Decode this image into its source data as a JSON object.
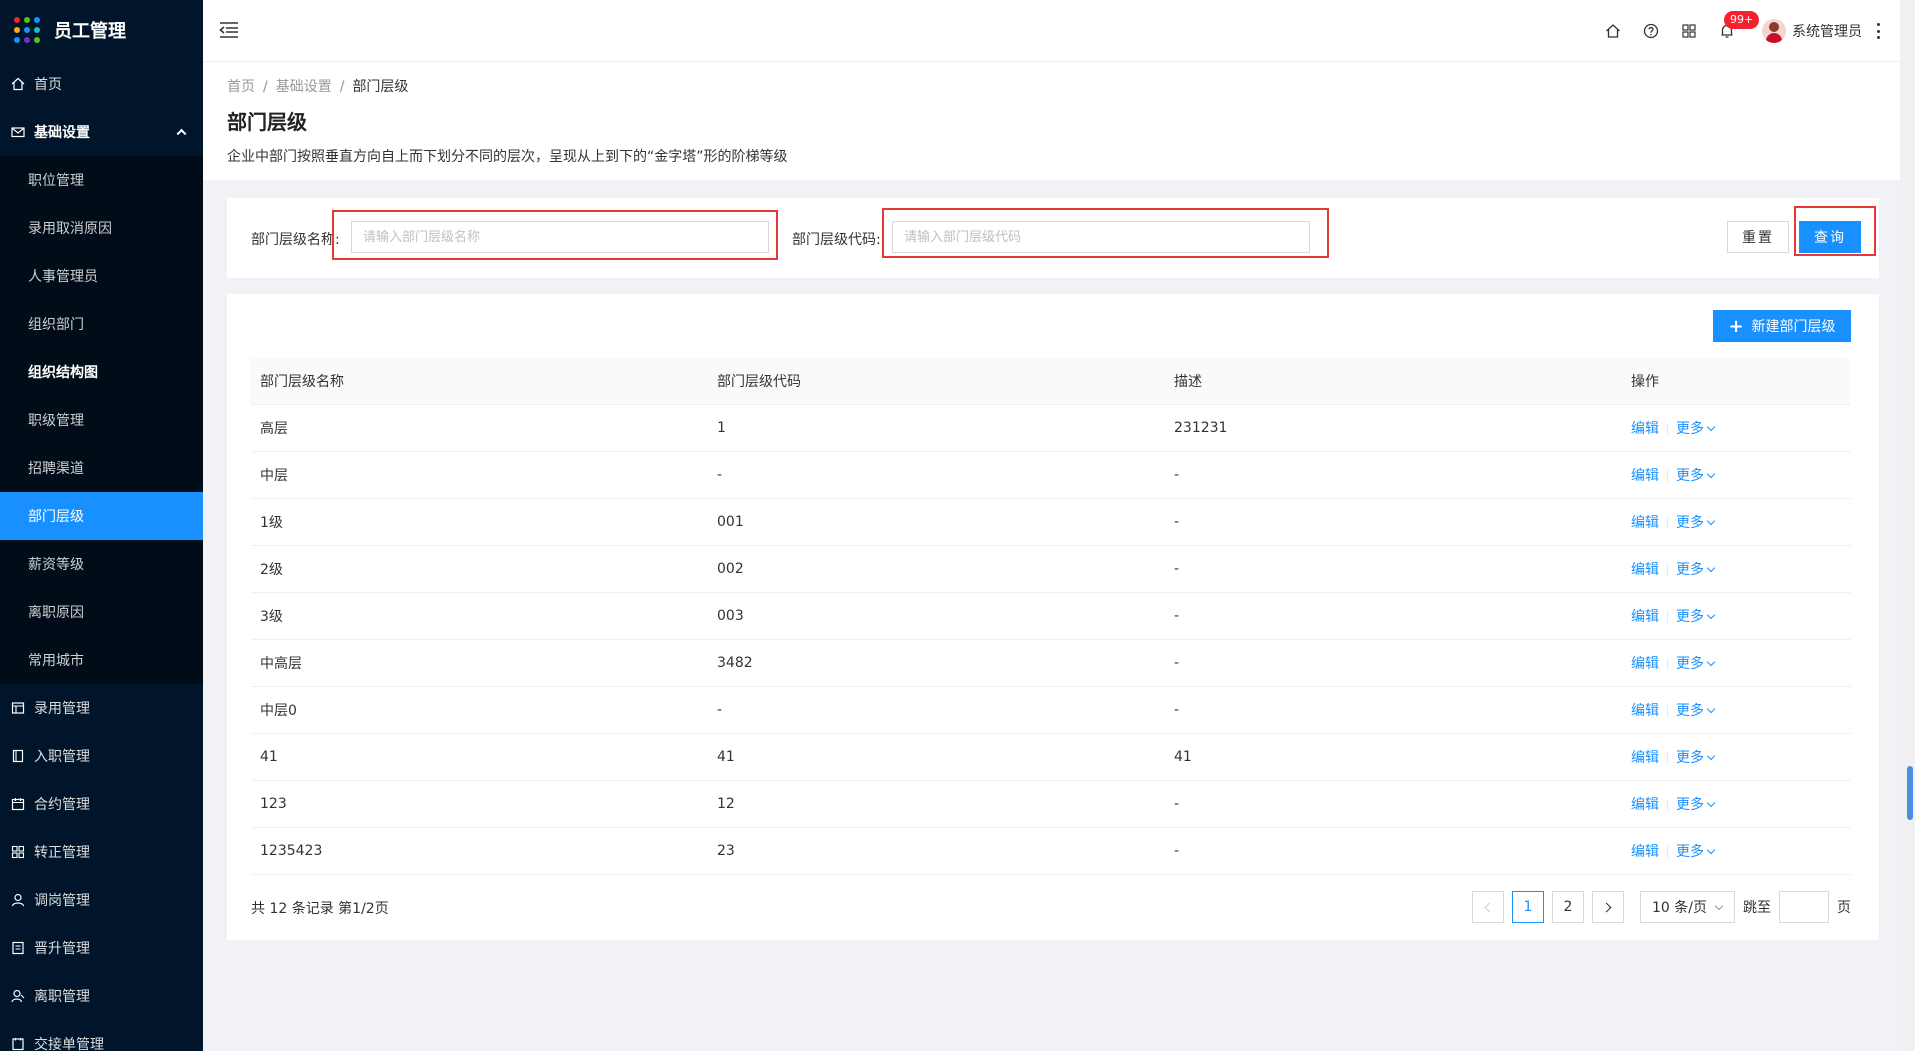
{
  "app": {
    "title": "员工管理"
  },
  "sidebar": {
    "items": [
      {
        "label": "首页"
      },
      {
        "label": "基础设置"
      },
      {
        "label": "录用管理"
      },
      {
        "label": "入职管理"
      },
      {
        "label": "合约管理"
      },
      {
        "label": "转正管理"
      },
      {
        "label": "调岗管理"
      },
      {
        "label": "晋升管理"
      },
      {
        "label": "离职管理"
      },
      {
        "label": "交接单管理"
      }
    ],
    "submenu": [
      {
        "label": "职位管理"
      },
      {
        "label": "录用取消原因"
      },
      {
        "label": "人事管理员"
      },
      {
        "label": "组织部门"
      },
      {
        "label": "组织结构图"
      },
      {
        "label": "职级管理"
      },
      {
        "label": "招聘渠道"
      },
      {
        "label": "部门层级"
      },
      {
        "label": "薪资等级"
      },
      {
        "label": "离职原因"
      },
      {
        "label": "常用城市"
      }
    ]
  },
  "header": {
    "badge": "99+",
    "user_name": "系统管理员"
  },
  "breadcrumb": [
    "首页",
    "基础设置",
    "部门层级"
  ],
  "page": {
    "title": "部门层级",
    "description": "企业中部门按照垂直方向自上而下划分不同的层次，呈现从上到下的“金字塔”形的阶梯等级"
  },
  "search": {
    "name_label": "部门层级名称:",
    "name_placeholder": "请输入部门层级名称",
    "code_label": "部门层级代码:",
    "code_placeholder": "请输入部门层级代码",
    "reset_label": "重置",
    "query_label": "查询"
  },
  "table": {
    "new_button": "新建部门层级",
    "columns": [
      "部门层级名称",
      "部门层级代码",
      "描述",
      "操作"
    ],
    "edit_label": "编辑",
    "more_label": "更多",
    "rows": [
      {
        "name": "高层",
        "code": "1",
        "desc": "231231"
      },
      {
        "name": "中层",
        "code": "-",
        "desc": "-"
      },
      {
        "name": "1级",
        "code": "001",
        "desc": "-"
      },
      {
        "name": "2级",
        "code": "002",
        "desc": "-"
      },
      {
        "name": "3级",
        "code": "003",
        "desc": "-"
      },
      {
        "name": "中高层",
        "code": "3482",
        "desc": "-"
      },
      {
        "name": "中层0",
        "code": "-",
        "desc": "-"
      },
      {
        "name": "41",
        "code": "41",
        "desc": "41"
      },
      {
        "name": "123",
        "code": "12",
        "desc": "-"
      },
      {
        "name": "1235423",
        "code": "23",
        "desc": "-"
      }
    ]
  },
  "pagination": {
    "total_text": "共 12 条记录 第1/2页",
    "pages": [
      "1",
      "2"
    ],
    "page_size": "10 条/页",
    "jump_label": "跳至",
    "page_unit": "页"
  },
  "colors": {
    "sidebar_bg": "#001529",
    "primary": "#1890ff",
    "highlight_box": "#e53935",
    "badge": "#f5222d"
  }
}
